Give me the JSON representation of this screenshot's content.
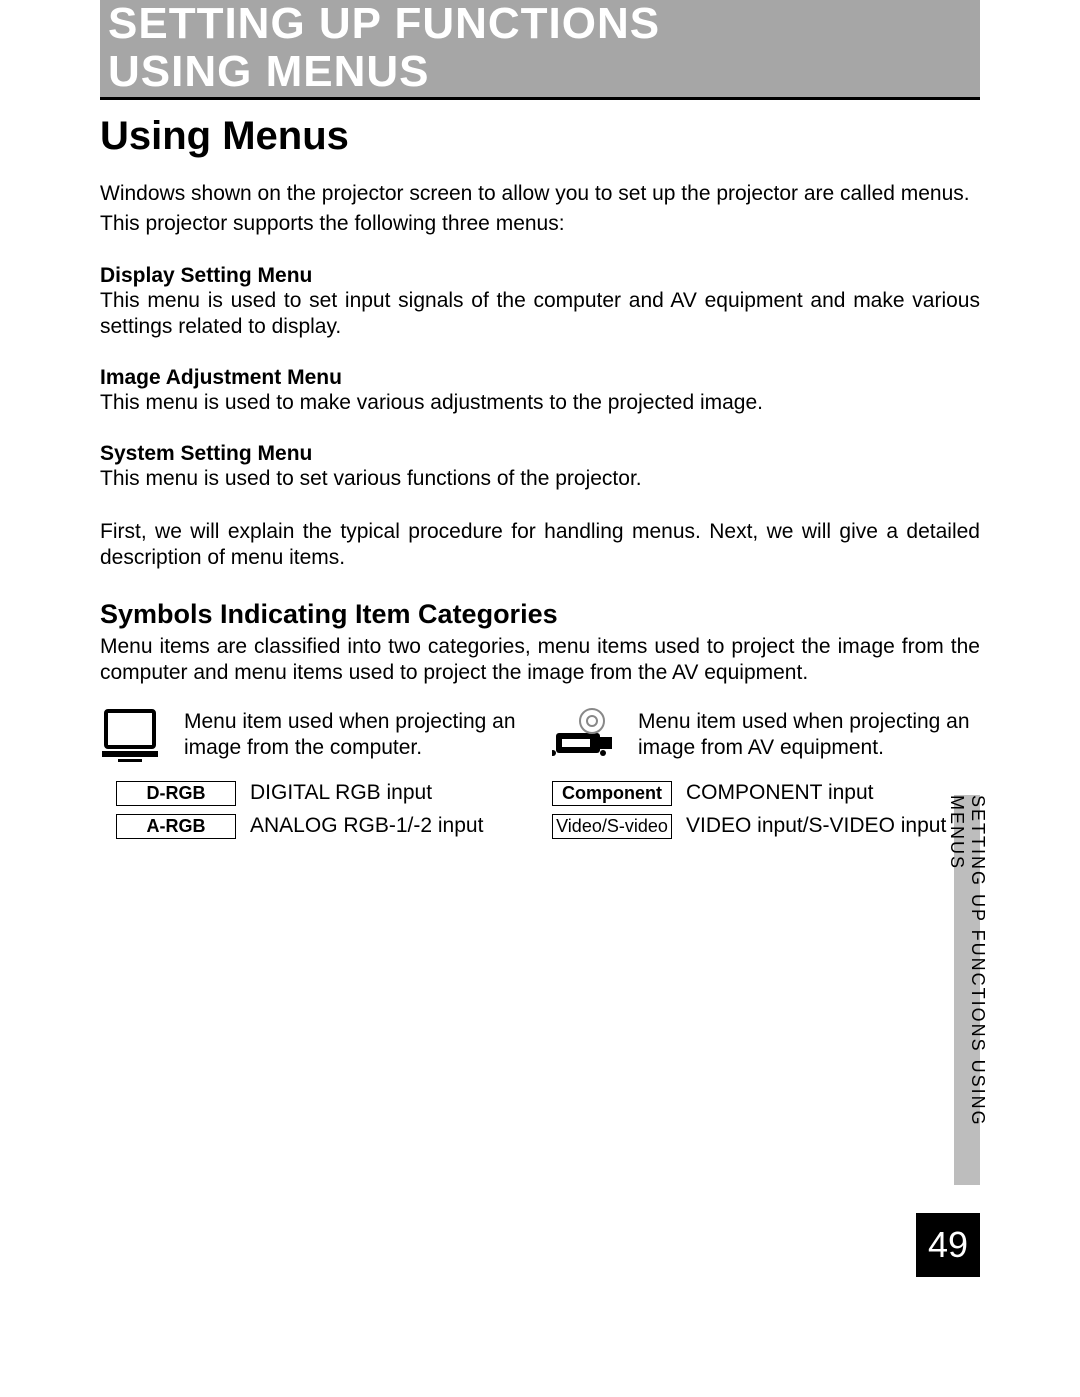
{
  "header": {
    "title_line1": "SETTING UP FUNCTIONS",
    "title_line2": "USING MENUS"
  },
  "section": {
    "heading": "Using Menus",
    "intro1": "Windows shown on the projector screen to allow you to set up the projector are called menus.",
    "intro2": "This projector supports the following three menus:",
    "menus": [
      {
        "name": "Display Setting Menu",
        "body": "This menu is used to set input signals of the computer and AV equipment and make various settings related to display."
      },
      {
        "name": "Image Adjustment Menu",
        "body": "This menu is used to make various adjustments to the projected image."
      },
      {
        "name": "System Setting Menu",
        "body": "This menu is used to set various functions of the projector."
      }
    ],
    "closing": "First, we will explain the typical procedure for handling menus. Next, we will give a detailed description of menu items."
  },
  "symbols": {
    "heading": "Symbols Indicating Item Categories",
    "intro": "Menu items are classified into two categories, menu items used to project the image from the computer and menu items used to project the image from the AV equipment.",
    "left": {
      "icon_desc": "Menu item used when projecting an image from the computer.",
      "badges": [
        {
          "label": "D-RGB",
          "desc": "DIGITAL RGB input",
          "bold": true
        },
        {
          "label": "A-RGB",
          "desc": "ANALOG RGB-1/-2 input",
          "bold": true
        }
      ]
    },
    "right": {
      "icon_desc": "Menu item used when projecting an image from AV equipment.",
      "badges": [
        {
          "label": "Component",
          "desc": "COMPONENT input",
          "bold": true
        },
        {
          "label": "Video/S-video",
          "desc": "VIDEO input/S-VIDEO input",
          "bold": false
        }
      ]
    }
  },
  "sidebar_label": "SETTING UP FUNCTIONS USING MENUS",
  "page_number": "49"
}
